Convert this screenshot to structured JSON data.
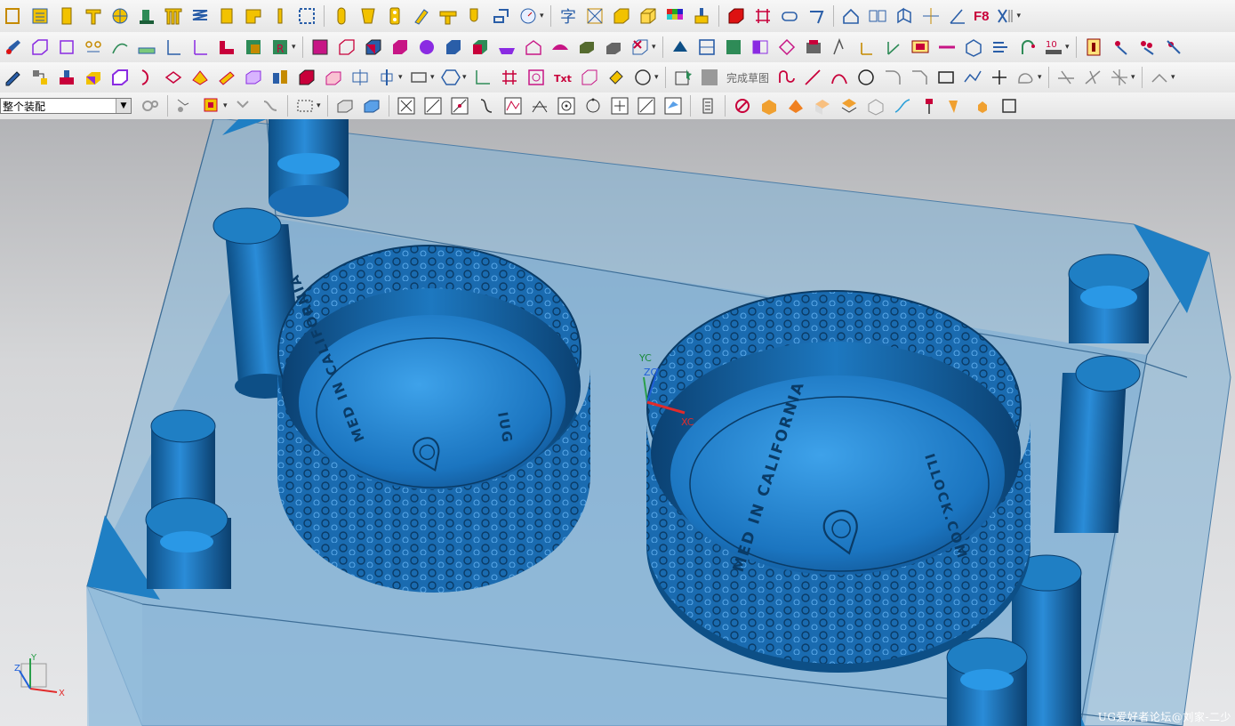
{
  "toolbar": {
    "text_icon_label": "字",
    "f8_label": "F8",
    "sketch_finish_label": "完成草图",
    "assembly_filter": "整个装配"
  },
  "viewport": {
    "wcs_labels": {
      "yc": "YC",
      "zc": "ZC",
      "xc": "XC"
    },
    "triad_labels": {
      "y": "Y",
      "x": "X",
      "z": "Z"
    },
    "engraving_text": "MED IN CALIFORNIA",
    "engraving_text_short": "IUG",
    "engraving_text_right": "ILLOCK.COM"
  },
  "watermark": "UG爱好者论坛@刘家-二少",
  "colors": {
    "part_blue": "#1f7fc4",
    "part_dark": "#0d4f86",
    "mold_plate": "#6aa4cf",
    "selection_highlight": "#ff3b30"
  }
}
